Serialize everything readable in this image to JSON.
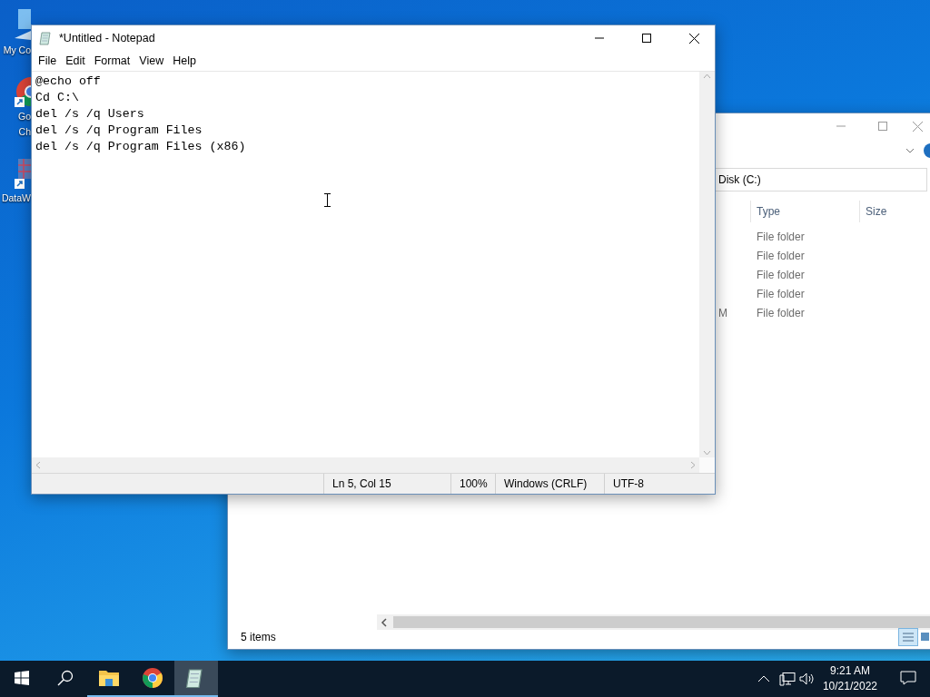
{
  "desktop_icons": [
    {
      "kind": "monitor",
      "lines": [
        "My Co"
      ]
    },
    {
      "kind": "chrome",
      "lines": [
        "Go",
        "Ch"
      ]
    },
    {
      "kind": "grid",
      "lines": [
        "DataW"
      ]
    }
  ],
  "explorer": {
    "address": "Disk (C:)",
    "columns": [
      "Type",
      "Size"
    ],
    "rows": [
      {
        "type": "File folder"
      },
      {
        "type": "File folder"
      },
      {
        "type": "File folder"
      },
      {
        "type": "File folder"
      },
      {
        "date_fragment": "M",
        "type": "File folder"
      }
    ],
    "status": "5 items"
  },
  "notepad": {
    "title": "*Untitled - Notepad",
    "menu": [
      "File",
      "Edit",
      "Format",
      "View",
      "Help"
    ],
    "lines": [
      "@echo off",
      "Cd C:\\",
      "del /s /q Users",
      "del /s /q Program Files",
      "del /s /q Program Files (x86)"
    ],
    "status": [
      "Ln 5, Col 15",
      "100%",
      "Windows (CRLF)",
      "UTF-8"
    ]
  },
  "taskbar": {
    "apps": [
      {
        "kind": "explorer",
        "selected": false
      },
      {
        "kind": "chrome",
        "selected": false
      },
      {
        "kind": "notepad",
        "selected": true
      }
    ],
    "time": "9:21 AM",
    "date": "10/21/2022"
  }
}
